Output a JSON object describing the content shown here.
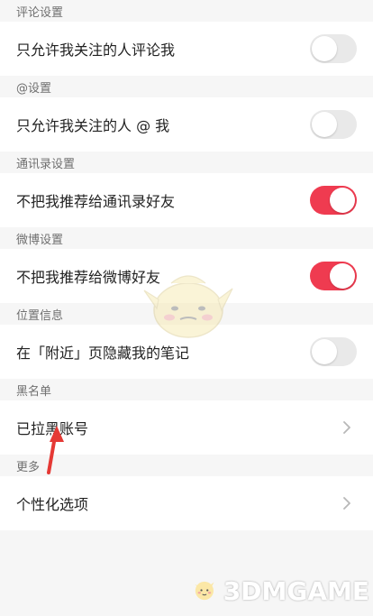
{
  "sections": [
    {
      "header": "评论设置",
      "row": {
        "label": "只允许我关注的人评论我",
        "toggle": "off"
      }
    },
    {
      "header": "@设置",
      "row": {
        "label": "只允许我关注的人 @ 我",
        "toggle": "off"
      }
    },
    {
      "header": "通讯录设置",
      "row": {
        "label": "不把我推荐给通讯录好友",
        "toggle": "on"
      }
    },
    {
      "header": "微博设置",
      "row": {
        "label": "不把我推荐给微博好友",
        "toggle": "on"
      }
    },
    {
      "header": "位置信息",
      "row": {
        "label": "在「附近」页隐藏我的笔记",
        "toggle": "off"
      }
    },
    {
      "header": "黑名单",
      "row": {
        "label": "已拉黑账号",
        "chevron": true
      }
    },
    {
      "header": "更多",
      "row": {
        "label": "个性化选项",
        "chevron": true
      }
    }
  ],
  "watermark": {
    "logo_text": "3DMGAME"
  },
  "colors": {
    "toggle_on": "#ef3b50",
    "toggle_off": "#e9e9e9",
    "background": "#f6f6f6",
    "arrow": "#e53935"
  }
}
